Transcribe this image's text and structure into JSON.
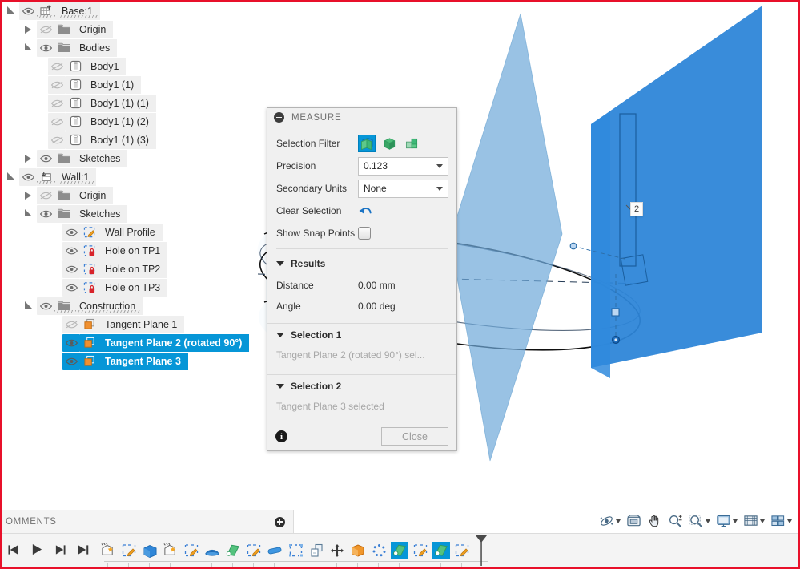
{
  "app": {
    "accent_blue": "#0696d7",
    "selection_blue": "#0696d7",
    "panel_bg": "#f0f0f0",
    "border_red": "#e8102a"
  },
  "browser_tree": {
    "items": [
      {
        "label": "Base:1",
        "indent": 0,
        "twist": "open",
        "visible": true,
        "icon": "component-icon",
        "selected": false,
        "dashed": true
      },
      {
        "label": "Origin",
        "indent": 1,
        "twist": "closed",
        "visible": false,
        "icon": "folder-icon",
        "selected": false,
        "dashed": false
      },
      {
        "label": "Bodies",
        "indent": 1,
        "twist": "open",
        "visible": true,
        "icon": "folder-icon",
        "selected": false,
        "dashed": false
      },
      {
        "label": "Body1",
        "indent": 2,
        "twist": "none",
        "visible": false,
        "icon": "body-icon",
        "selected": false,
        "dashed": false
      },
      {
        "label": "Body1 (1)",
        "indent": 2,
        "twist": "none",
        "visible": false,
        "icon": "body-icon",
        "selected": false,
        "dashed": false
      },
      {
        "label": "Body1 (1) (1)",
        "indent": 2,
        "twist": "none",
        "visible": false,
        "icon": "body-icon",
        "selected": false,
        "dashed": false
      },
      {
        "label": "Body1 (1) (2)",
        "indent": 2,
        "twist": "none",
        "visible": false,
        "icon": "body-icon",
        "selected": false,
        "dashed": false
      },
      {
        "label": "Body1 (1) (3)",
        "indent": 2,
        "twist": "none",
        "visible": false,
        "icon": "body-icon",
        "selected": false,
        "dashed": false
      },
      {
        "label": "Sketches",
        "indent": 1,
        "twist": "closed",
        "visible": true,
        "icon": "folder-icon",
        "selected": false,
        "dashed": false
      },
      {
        "label": "Wall:1",
        "indent": 0,
        "twist": "open",
        "visible": true,
        "icon": "component-icon",
        "selected": false,
        "dashed": true
      },
      {
        "label": "Origin",
        "indent": 1,
        "twist": "closed",
        "visible": false,
        "icon": "folder-icon",
        "selected": false,
        "dashed": false
      },
      {
        "label": "Sketches",
        "indent": 1,
        "twist": "open",
        "visible": true,
        "icon": "folder-icon",
        "selected": false,
        "dashed": false
      },
      {
        "label": "Wall Profile",
        "indent": 2,
        "twist": "none",
        "visible": true,
        "icon": "sketch-icon",
        "selected": false,
        "dashed": false
      },
      {
        "label": "Hole on TP1",
        "indent": 2,
        "twist": "none",
        "visible": true,
        "icon": "sketch-locked-icon",
        "selected": false,
        "dashed": false
      },
      {
        "label": "Hole on TP2",
        "indent": 2,
        "twist": "none",
        "visible": true,
        "icon": "sketch-locked-icon",
        "selected": false,
        "dashed": false
      },
      {
        "label": "Hole on TP3",
        "indent": 2,
        "twist": "none",
        "visible": true,
        "icon": "sketch-locked-icon",
        "selected": false,
        "dashed": false
      },
      {
        "label": "Construction",
        "indent": 1,
        "twist": "open",
        "visible": true,
        "icon": "folder-icon",
        "selected": false,
        "dashed": true
      },
      {
        "label": "Tangent Plane 1",
        "indent": 2,
        "twist": "none",
        "visible": false,
        "icon": "plane-icon",
        "selected": false,
        "dashed": false
      },
      {
        "label": "Tangent Plane 2 (rotated 90°)",
        "indent": 2,
        "twist": "none",
        "visible": true,
        "icon": "plane-icon",
        "selected": true,
        "dashed": false
      },
      {
        "label": "Tangent Plane 3",
        "indent": 2,
        "twist": "none",
        "visible": true,
        "icon": "plane-icon",
        "selected": true,
        "dashed": false
      }
    ]
  },
  "measure_dialog": {
    "title": "MEASURE",
    "collapse_icon": "collapse-icon",
    "selection_filter": {
      "label": "Selection Filter",
      "options": [
        {
          "name": "select-face-filter",
          "icon": "face-filter-icon",
          "active": true
        },
        {
          "name": "select-body-filter",
          "icon": "body-filter-icon",
          "active": false
        },
        {
          "name": "select-component-filter",
          "icon": "component-filter-icon",
          "active": false
        }
      ]
    },
    "precision": {
      "label": "Precision",
      "value": "0.123"
    },
    "secondary_units": {
      "label": "Secondary Units",
      "value": "None"
    },
    "clear_selection": {
      "label": "Clear Selection",
      "icon": "undo-arrow-icon"
    },
    "show_snap_points": {
      "label": "Show Snap Points",
      "checked": false
    },
    "results": {
      "header": "Results",
      "rows": [
        {
          "key": "Distance",
          "value": "0.00 mm"
        },
        {
          "key": "Angle",
          "value": "0.00 deg"
        }
      ]
    },
    "selection_1": {
      "header": "Selection 1",
      "text": "Tangent Plane 2 (rotated 90°) sel..."
    },
    "selection_2": {
      "header": "Selection 2",
      "text": "Tangent Plane 3 selected"
    },
    "footer": {
      "info_icon": "info-icon",
      "info_glyph": "i",
      "close_label": "Close"
    }
  },
  "comments_panel": {
    "title": "OMMENTS",
    "add_icon": "add-comment-icon"
  },
  "navigation_bar": {
    "items": [
      {
        "name": "orbit-tool",
        "icon": "orbit-icon",
        "has_caret": true
      },
      {
        "name": "look-at-tool",
        "icon": "look-at-icon",
        "has_caret": false
      },
      {
        "name": "pan-tool",
        "icon": "pan-hand-icon",
        "has_caret": false
      },
      {
        "name": "zoom-tool",
        "icon": "zoom-plusminus-icon",
        "has_caret": false
      },
      {
        "name": "zoom-window-tool",
        "icon": "zoom-window-icon",
        "has_caret": true
      },
      {
        "name": "display-settings",
        "icon": "monitor-icon",
        "has_caret": true
      },
      {
        "name": "grid-settings",
        "icon": "grid-icon",
        "has_caret": true
      },
      {
        "name": "viewport-layout",
        "icon": "viewport-grid-icon",
        "has_caret": true
      }
    ]
  },
  "timeline": {
    "playback": [
      {
        "name": "step-backward-button",
        "icon": "step-back-icon"
      },
      {
        "name": "play-button",
        "icon": "play-icon"
      },
      {
        "name": "step-forward-button",
        "icon": "step-forward-icon"
      },
      {
        "name": "end-button",
        "icon": "go-to-end-icon"
      }
    ],
    "features": [
      {
        "name": "timeline-new-component-1",
        "icon": "new-component-icon",
        "selected": false,
        "sparkle": true
      },
      {
        "name": "timeline-sketch-1",
        "icon": "sketch-icon",
        "selected": false,
        "sparkle": false
      },
      {
        "name": "timeline-extrude-1",
        "icon": "extrude-icon",
        "selected": false,
        "sparkle": false
      },
      {
        "name": "timeline-new-component-2",
        "icon": "new-component-icon",
        "selected": false,
        "sparkle": true
      },
      {
        "name": "timeline-sketch-2",
        "icon": "sketch-icon",
        "selected": false,
        "sparkle": false
      },
      {
        "name": "timeline-revolve",
        "icon": "revolve-icon",
        "selected": false,
        "sparkle": false
      },
      {
        "name": "timeline-tangent-plane-1",
        "icon": "tangent-plane-icon",
        "selected": false,
        "sparkle": false
      },
      {
        "name": "timeline-sketch-3",
        "icon": "sketch-icon",
        "selected": false,
        "sparkle": false
      },
      {
        "name": "timeline-fillet",
        "icon": "fillet-icon",
        "selected": false,
        "sparkle": false
      },
      {
        "name": "timeline-rectangular-pattern",
        "icon": "pattern-icon",
        "selected": false,
        "sparkle": false
      },
      {
        "name": "timeline-copy-paste",
        "icon": "copy-paste-icon",
        "selected": false,
        "sparkle": false
      },
      {
        "name": "timeline-move",
        "icon": "move-icon",
        "selected": false,
        "sparkle": false
      },
      {
        "name": "timeline-combine",
        "icon": "combine-icon",
        "selected": false,
        "sparkle": false
      },
      {
        "name": "timeline-circular-pattern",
        "icon": "circular-pattern-icon",
        "selected": false,
        "sparkle": false
      },
      {
        "name": "timeline-tangent-plane-2",
        "icon": "tangent-plane-icon",
        "selected": true,
        "sparkle": false
      },
      {
        "name": "timeline-sketch-4",
        "icon": "sketch-icon",
        "selected": false,
        "sparkle": false
      },
      {
        "name": "timeline-tangent-plane-3",
        "icon": "tangent-plane-icon",
        "selected": true,
        "sparkle": false
      },
      {
        "name": "timeline-sketch-5",
        "icon": "sketch-icon",
        "selected": false,
        "sparkle": false
      }
    ],
    "end_marker": "timeline-end-marker"
  },
  "viewport": {
    "dimension_label": "2",
    "planes": [
      {
        "name": "tangent-plane-3-highlight",
        "color": "#2e86d8",
        "opacity": 0.92
      },
      {
        "name": "tangent-plane-2-highlight",
        "color": "#6ea8d8",
        "opacity": 0.72
      }
    ]
  }
}
